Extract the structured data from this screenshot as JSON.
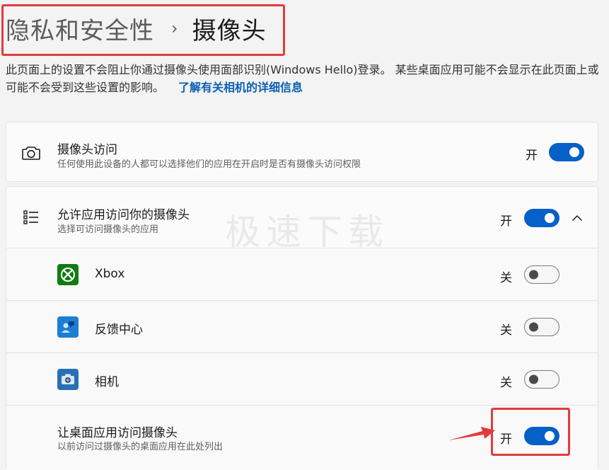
{
  "breadcrumb": {
    "parent": "隐私和安全性",
    "separator": "›",
    "current": "摄像头"
  },
  "description": {
    "text": "此页面上的设置不会阻止你通过摄像头使用面部识别(Windows Hello)登录。 某些桌面应用可能不会显示在此页面上或可能不会受到这些设置的影响。",
    "link": "了解有关相机的详细信息"
  },
  "camera_access": {
    "title": "摄像头访问",
    "subtitle": "任何使用此设备的人都可以选择他们的应用在开启时是否有摄像头访问权限",
    "state_label": "开",
    "enabled": true
  },
  "app_access": {
    "title": "允许应用访问你的摄像头",
    "subtitle": "选择可访问摄像头的应用",
    "state_label": "开",
    "enabled": true,
    "expanded": true,
    "apps": [
      {
        "name": "Xbox",
        "state_label": "关",
        "enabled": false,
        "icon": "xbox-icon",
        "color": "#107c10"
      },
      {
        "name": "反馈中心",
        "state_label": "关",
        "enabled": false,
        "icon": "feedback-hub-icon",
        "color": "#1a7fd4"
      },
      {
        "name": "相机",
        "state_label": "关",
        "enabled": false,
        "icon": "camera-app-icon",
        "color": "#2a6fb5"
      }
    ]
  },
  "desktop_access": {
    "title": "让桌面应用访问摄像头",
    "subtitle": "以前访问过摄像头的桌面应用在此处列出",
    "state_label": "开",
    "enabled": true
  },
  "watermark": "极速下载",
  "colors": {
    "accent": "#0560c8",
    "link": "#0a5fb4",
    "highlight": "#e23b3b"
  }
}
